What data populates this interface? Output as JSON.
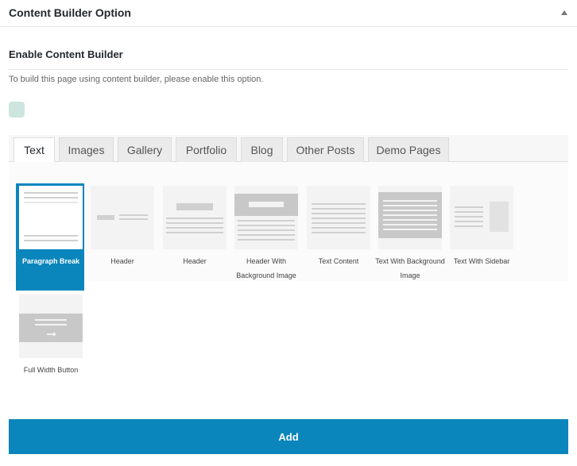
{
  "panel": {
    "title": "Content Builder Option"
  },
  "section": {
    "title": "Enable Content Builder",
    "description": "To build this page using content builder, please enable this option."
  },
  "tabs": [
    {
      "label": "Text",
      "active": true
    },
    {
      "label": "Images"
    },
    {
      "label": "Gallery"
    },
    {
      "label": "Portfolio"
    },
    {
      "label": "Blog"
    },
    {
      "label": "Other Posts"
    },
    {
      "label": "Demo Pages"
    }
  ],
  "items": [
    {
      "label": "Paragraph Break",
      "selected": true
    },
    {
      "label": "Header"
    },
    {
      "label": "Header"
    },
    {
      "label": "Header With Background Image"
    },
    {
      "label": "Text Content"
    },
    {
      "label": "Text With Background Image"
    },
    {
      "label": "Text With Sidebar"
    },
    {
      "label": "Full Width Button"
    }
  ],
  "add_button": "Add",
  "colors": {
    "accent": "#0a86bc",
    "toggle": "#cde5de"
  }
}
